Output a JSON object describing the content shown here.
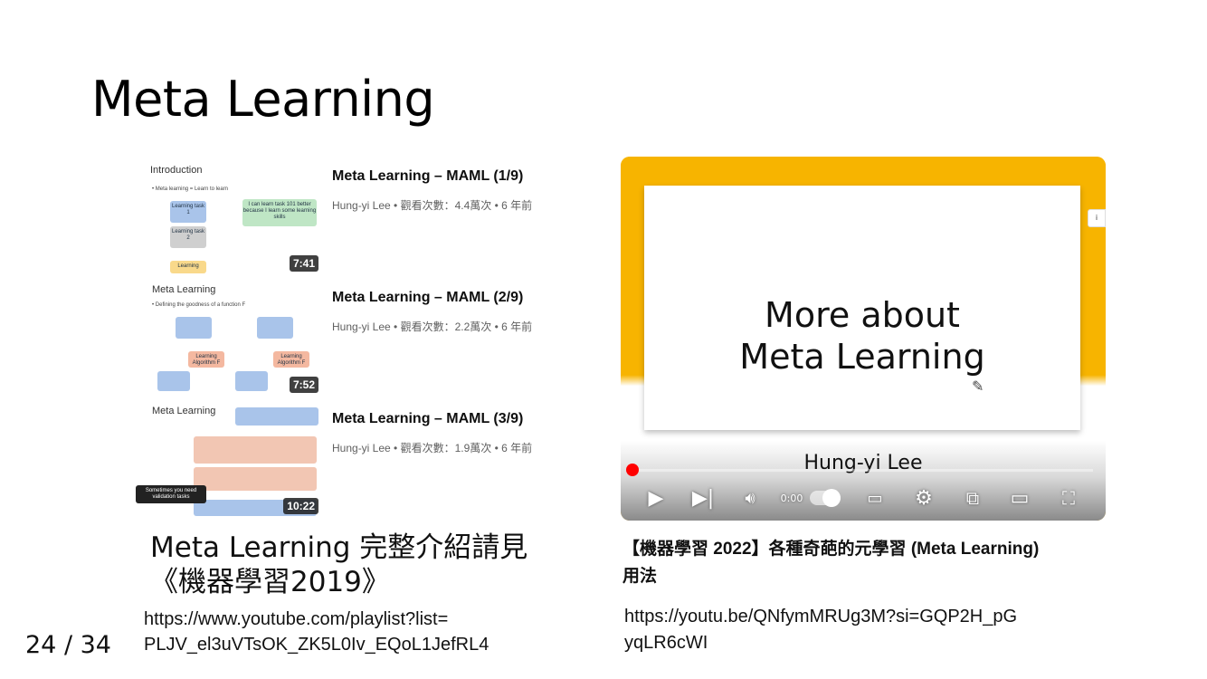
{
  "slide": {
    "title": "Meta Learning",
    "page_number": "24 / 34"
  },
  "playlist": {
    "items": [
      {
        "title": "Meta Learning – MAML (1/9)",
        "meta": "Hung-yi Lee • 觀看次數：4.4萬次 • 6 年前",
        "duration": "7:41",
        "thumb_heading": "Introduction"
      },
      {
        "title": "Meta Learning – MAML (2/9)",
        "meta": "Hung-yi Lee • 觀看次數：2.2萬次 • 6 年前",
        "duration": "7:52",
        "thumb_heading": "Meta Learning"
      },
      {
        "title": "Meta Learning – MAML (3/9)",
        "meta": "Hung-yi Lee • 觀看次數：1.9萬次 • 6 年前",
        "duration": "10:22",
        "thumb_heading": "Meta Learning"
      }
    ],
    "caption_line1": "Meta Learning 完整介紹請見",
    "caption_line2": "《機器學習2019》",
    "link_line1": "https://www.youtube.com/playlist?list=",
    "link_line2": "PLJV_el3uVTsOK_ZK5L0Iv_EQoL1JefRL4"
  },
  "video": {
    "slide_line1": "More about",
    "slide_line2": "Meta Learning",
    "presenter": "Hung-yi Lee",
    "time": "0:00",
    "caption_line1": "【機器學習 2022】各種奇葩的元學習 (Meta Learning)",
    "caption_line2": "用法",
    "link_line1": "https://youtu.be/QNfymMRUg3M?si=GQP2H_pG",
    "link_line2": "yqLR6cWI",
    "colors": {
      "frame": "#f7b400",
      "progress": "#ff0000"
    },
    "icons": [
      "play-icon",
      "next-icon",
      "volume-icon",
      "autoplay-toggle",
      "subtitles-icon",
      "settings-icon",
      "miniplayer-icon",
      "theater-icon",
      "fullscreen-icon"
    ]
  }
}
